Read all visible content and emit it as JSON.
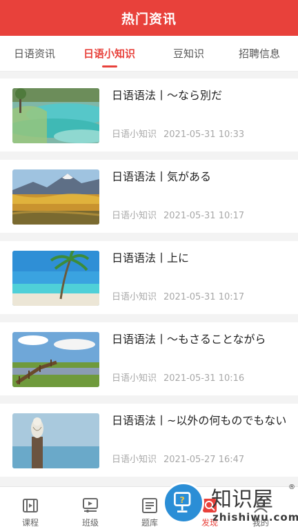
{
  "header": {
    "title": "热门资讯"
  },
  "tabs": [
    {
      "label": "日语资讯",
      "active": false
    },
    {
      "label": "日语小知识",
      "active": true
    },
    {
      "label": "豆知识",
      "active": false
    },
    {
      "label": "招聘信息",
      "active": false
    }
  ],
  "articles": [
    {
      "title": "日语语法丨～なら別だ",
      "category": "日语小知识",
      "time": "2021-05-31 10:33",
      "image": "turquoise-pools"
    },
    {
      "title": "日语语法丨気がある",
      "category": "日语小知识",
      "time": "2021-05-31 10:17",
      "image": "autumn-mountain"
    },
    {
      "title": "日语语法丨上に",
      "category": "日语小知识",
      "time": "2021-05-31 10:17",
      "image": "palm-beach"
    },
    {
      "title": "日语语法丨～もさることながら",
      "category": "日语小知识",
      "time": "2021-05-31 10:16",
      "image": "wooden-bridge"
    },
    {
      "title": "日语语法丨~以外の何ものでもない",
      "category": "日语小知识",
      "time": "2021-05-27 16:47",
      "image": "owl-on-post"
    }
  ],
  "bottom_nav": [
    {
      "label": "课程",
      "icon": "course-icon",
      "active": false
    },
    {
      "label": "班级",
      "icon": "class-icon",
      "active": false
    },
    {
      "label": "题库",
      "icon": "question-bank-icon",
      "active": false
    },
    {
      "label": "发现",
      "icon": "discover-icon",
      "active": true
    },
    {
      "label": "我的",
      "icon": "profile-icon",
      "active": false
    }
  ],
  "watermark": {
    "text": "知识屋",
    "mark": "®",
    "url": "zhishiwu.com"
  },
  "colors": {
    "accent": "#e8413b",
    "muted": "#a8a8a8",
    "background": "#f3f3f3"
  }
}
